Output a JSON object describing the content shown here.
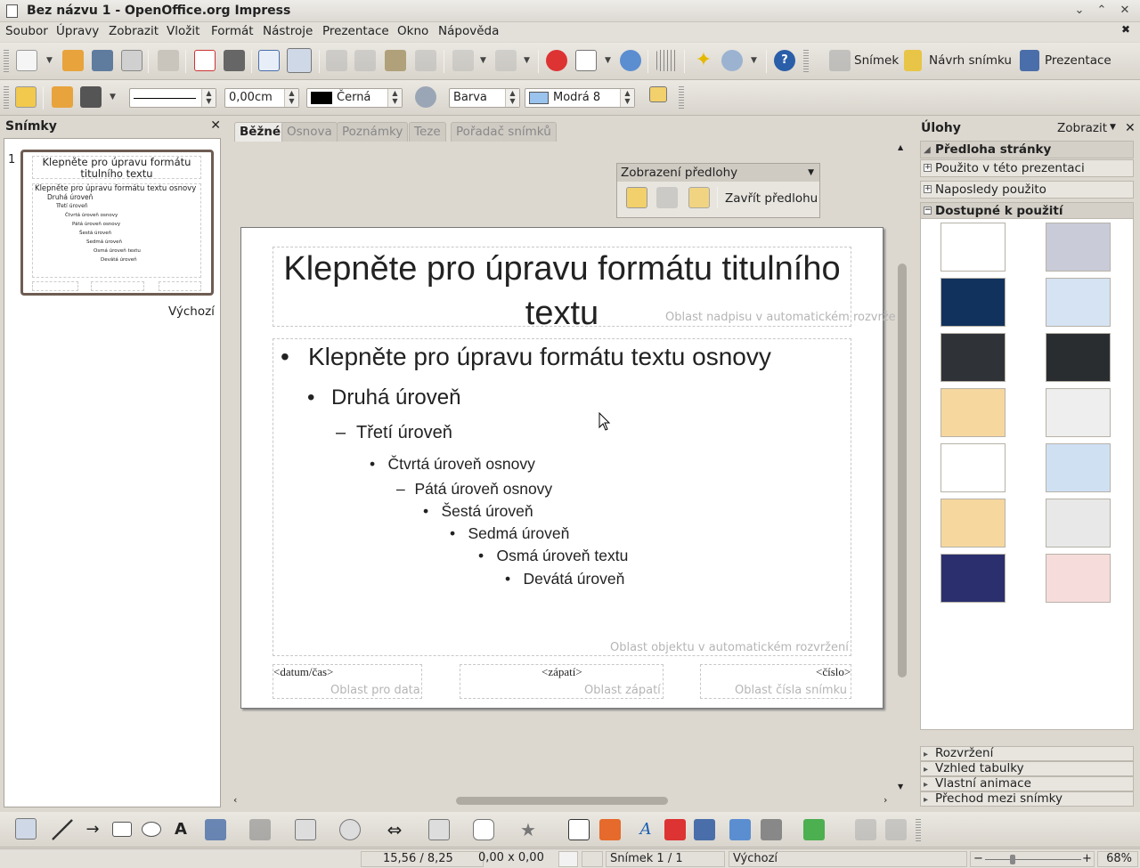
{
  "window": {
    "title": "Bez názvu 1 - OpenOffice.org Impress"
  },
  "menu": [
    "Soubor",
    "Úpravy",
    "Zobrazit",
    "Vložit",
    "Formát",
    "Nástroje",
    "Prezentace",
    "Okno",
    "Nápověda"
  ],
  "toolbar1": {
    "slide_label": "Snímek",
    "design_label": "Návrh snímku",
    "presentation_label": "Prezentace"
  },
  "toolbar2": {
    "line_width": "0,00cm",
    "line_color": "Černá",
    "area_style": "Barva",
    "area_color": "Modrá 8"
  },
  "slides_panel": {
    "title": "Snímky",
    "slide_number": "1",
    "master_name": "Výchozí",
    "thumb_title": "Klepněte pro úpravu formátu titulního textu",
    "thumb_lines": [
      "Klepněte pro úpravu formátu textu osnovy",
      "Druhá úroveň",
      "Třetí úroveň",
      "Čtvrtá úroveň osnovy",
      "Pátá úroveň osnovy",
      "Šestá úroveň",
      "Sedmá úroveň",
      "Osmá úroveň textu",
      "Devátá úroveň"
    ]
  },
  "tabs": [
    "Běžné",
    "Osnova",
    "Poznámky",
    "Teze",
    "Pořadač snímků"
  ],
  "master_toolbar": {
    "title": "Zobrazení předlohy",
    "close_label": "Zavřít předlohu"
  },
  "slide": {
    "title": "Klepněte pro úpravu formátu titulního textu",
    "title_area_label": "Oblast nadpisu v automatickém rozvržení",
    "outline": [
      "Klepněte pro úpravu formátu textu osnovy",
      "Druhá úroveň",
      "Třetí úroveň",
      "Čtvrtá úroveň osnovy",
      "Pátá úroveň osnovy",
      "Šestá úroveň",
      "Sedmá úroveň",
      "Osmá úroveň textu",
      "Devátá úroveň"
    ],
    "outline_bullets": [
      "•",
      "•",
      "–",
      "•",
      "–",
      "•",
      "•",
      "•",
      "•"
    ],
    "object_area_label": "Oblast objektu v automatickém rozvržení",
    "date_field": "<datum/čas>",
    "date_area_label": "Oblast pro data",
    "footer_field": "<zápatí>",
    "footer_area_label": "Oblast zápatí",
    "number_field": "<číslo>",
    "number_area_label": "Oblast čísla snímku"
  },
  "tasks_panel": {
    "title": "Úlohy",
    "view_label": "Zobrazit",
    "sections_top": [
      "Předloha stránky",
      "Použito v této prezentaci",
      "Naposledy použito",
      "Dostupné k použití"
    ],
    "sections_bottom": [
      "Rozvržení",
      "Vzhled tabulky",
      "Vlastní animace",
      "Přechod mezi snímky"
    ],
    "layout_colors": [
      "#ffffff",
      "#c9cbd8",
      "#12325e",
      "#d5e3f2",
      "#2f3338",
      "#2a2d30",
      "#f6d79e",
      "#eeeeee",
      "#ffffff",
      "#cfe0f3",
      "#f6d79e",
      "#e8e8e8",
      "#2b2f6e",
      "#f7dcdc"
    ]
  },
  "status": {
    "position": "15,56 / 8,25",
    "size": "0,00 x 0,00",
    "slide": "Snímek 1 / 1",
    "master": "Výchozí",
    "zoom": "68%"
  },
  "colors": {
    "accent": "#1a5fb4",
    "line_color": "#000000",
    "area_color": "#9ac3ee"
  }
}
